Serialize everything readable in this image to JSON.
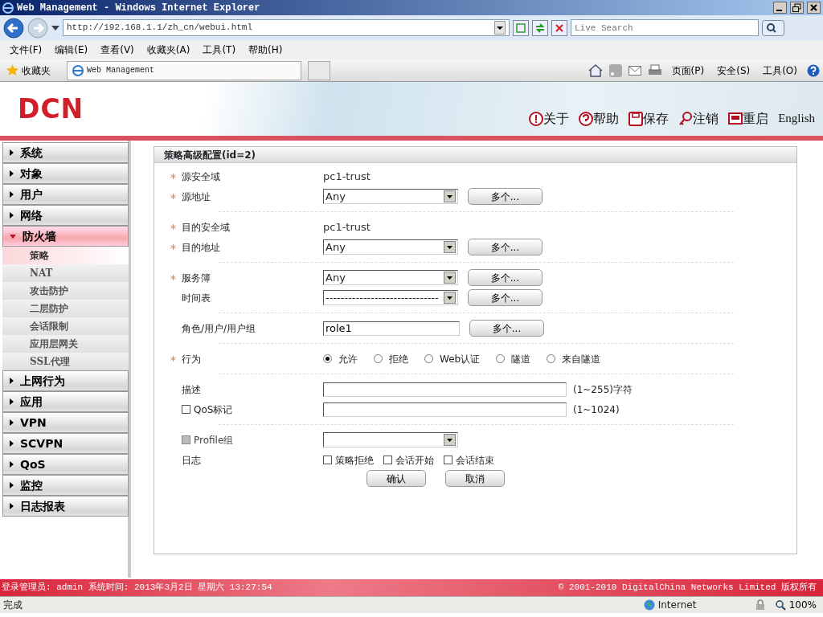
{
  "window": {
    "title": "Web Management - Windows Internet Explorer"
  },
  "browser": {
    "url": "http://192.168.1.1/zh_cn/webui.html",
    "search_placeholder": "Live Search",
    "menu": [
      "文件(F)",
      "编辑(E)",
      "查看(V)",
      "收藏夹(A)",
      "工具(T)",
      "帮助(H)"
    ],
    "favorites": "收藏夹",
    "tab": "Web Management",
    "toolbar": [
      "页面(P)",
      "安全(S)",
      "工具(O)"
    ]
  },
  "header": {
    "logo": "DCN",
    "links": [
      {
        "label": "关于",
        "kind": "about"
      },
      {
        "label": "帮助",
        "kind": "help"
      },
      {
        "label": "保存",
        "kind": "save"
      },
      {
        "label": "注销",
        "kind": "logout"
      },
      {
        "label": "重启",
        "kind": "restart"
      },
      {
        "label": "English",
        "kind": "plain"
      }
    ]
  },
  "sidebar": {
    "items": [
      {
        "label": "系统",
        "expanded": false
      },
      {
        "label": "对象",
        "expanded": false
      },
      {
        "label": "用户",
        "expanded": false
      },
      {
        "label": "网络",
        "expanded": false
      },
      {
        "label": "防火墙",
        "expanded": true,
        "children": [
          {
            "label": "策略",
            "selected": true
          },
          {
            "label": "NAT",
            "selected": false
          },
          {
            "label": "攻击防护",
            "selected": false
          },
          {
            "label": "二层防护",
            "selected": false
          },
          {
            "label": "会话限制",
            "selected": false
          },
          {
            "label": "应用层网关",
            "selected": false
          },
          {
            "label": "SSL代理",
            "selected": false
          }
        ]
      },
      {
        "label": "上网行为",
        "expanded": false
      },
      {
        "label": "应用",
        "expanded": false
      },
      {
        "label": "VPN",
        "expanded": false
      },
      {
        "label": "SCVPN",
        "expanded": false
      },
      {
        "label": "QoS",
        "expanded": false
      },
      {
        "label": "监控",
        "expanded": false
      },
      {
        "label": "日志报表",
        "expanded": false
      }
    ]
  },
  "form": {
    "title": "策略高级配置(id=2)",
    "sections": [
      {
        "rows": [
          {
            "kind": "text",
            "label": "源安全域",
            "required": true,
            "value": "pc1-trust"
          },
          {
            "kind": "select",
            "label": "源地址",
            "required": true,
            "value": "Any",
            "button": "多个..."
          }
        ]
      },
      {
        "rows": [
          {
            "kind": "text",
            "label": "目的安全域",
            "required": true,
            "value": "pc1-trust"
          },
          {
            "kind": "select",
            "label": "目的地址",
            "required": true,
            "value": "Any",
            "button": "多个..."
          }
        ]
      },
      {
        "rows": [
          {
            "kind": "select",
            "label": "服务簿",
            "required": true,
            "value": "Any",
            "button": "多个..."
          },
          {
            "kind": "select",
            "label": "时间表",
            "required": false,
            "value": "------------------------------",
            "button": "多个..."
          }
        ]
      },
      {
        "rows": [
          {
            "kind": "input",
            "label": "角色/用户/用户组",
            "required": false,
            "value": "role1",
            "button": "多个..."
          }
        ]
      },
      {
        "rows": [
          {
            "kind": "radio",
            "label": "行为",
            "required": true,
            "options": [
              {
                "label": "允许",
                "selected": true
              },
              {
                "label": "拒绝",
                "selected": false
              },
              {
                "label": "Web认证",
                "selected": false
              },
              {
                "label": "隧道",
                "selected": false
              },
              {
                "label": "来自隧道",
                "selected": false
              }
            ]
          }
        ]
      },
      {
        "rows": [
          {
            "kind": "wide",
            "label": "描述",
            "required": false,
            "suffix": "(1~255)字符"
          },
          {
            "kind": "wide",
            "label": "QoS标记",
            "required": false,
            "checkbox": {
              "checked": false,
              "disabled": false
            },
            "suffix": "(1~1024)"
          }
        ]
      },
      {
        "rows": [
          {
            "kind": "select",
            "label": "Profile组",
            "required": false,
            "checkbox": {
              "checked": false,
              "disabled": true
            }
          },
          {
            "kind": "checks",
            "label": "日志",
            "required": false,
            "options": [
              {
                "label": "策略拒绝",
                "checked": false
              },
              {
                "label": "会话开始",
                "checked": false
              },
              {
                "label": "会话结束",
                "checked": false
              }
            ]
          }
        ]
      }
    ],
    "buttons": [
      "确认",
      "取消"
    ]
  },
  "footer": {
    "left": "登录管理员: admin 系统时间: 2013年3月2日 星期六 13:27:54",
    "right": "© 2001-2010 DigitalChina Networks Limited 版权所有"
  },
  "status_bar": {
    "text": "完成",
    "zone": "Internet",
    "zoom": "100%"
  }
}
